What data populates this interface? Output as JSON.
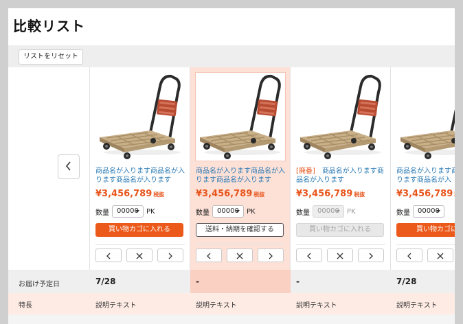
{
  "page": {
    "title": "比較リスト"
  },
  "toolbar": {
    "reset_label": "リストをリセット"
  },
  "rows": {
    "delivery_label": "お届け予定日",
    "feature_label": "特長"
  },
  "icons": {
    "prev": "chevron-left-icon",
    "nav_left": "chevron-left-icon",
    "nav_remove": "close-icon",
    "nav_right": "chevron-right-icon",
    "dropdown": "caret-down-icon"
  },
  "colors": {
    "accent": "#ec5a1b",
    "price": "#e8551c",
    "link": "#2a7ab5",
    "highlight": "#fde1d7"
  },
  "products": [
    {
      "tag": "",
      "name": "商品名が入ります商品名が入ります商品名が入ります",
      "price": "¥3,456,789",
      "tax": "税抜",
      "qty_label": "数量",
      "qty": "00000",
      "unit": "PK",
      "action": "買い物カゴに入れる",
      "delivery": "7/28",
      "feature": "説明テキスト"
    },
    {
      "tag": "",
      "name": "商品名が入ります商品名が入ります商品名が入ります",
      "price": "¥3,456,789",
      "tax": "税抜",
      "qty_label": "数量",
      "qty": "00000",
      "unit": "PK",
      "action": "送料・納期を確認する",
      "delivery": "-",
      "feature": "説明テキスト"
    },
    {
      "tag": "[廃番]",
      "name": "商品名が入ります商品名が入ります",
      "price": "¥3,456,789",
      "tax": "税抜",
      "qty_label": "数量",
      "qty": "00000",
      "unit": "PK",
      "action": "買い物カゴに入れる",
      "delivery": "-",
      "feature": "説明テキスト"
    },
    {
      "tag": "",
      "name": "商品名が入ります商品名が入ります商品名が入",
      "price": "¥3,456,789",
      "tax": "税抜",
      "qty_label": "数量",
      "qty": "00000",
      "unit": "",
      "action": "買い物カゴに入",
      "delivery": "7/28",
      "feature": "説明テキスト"
    }
  ]
}
